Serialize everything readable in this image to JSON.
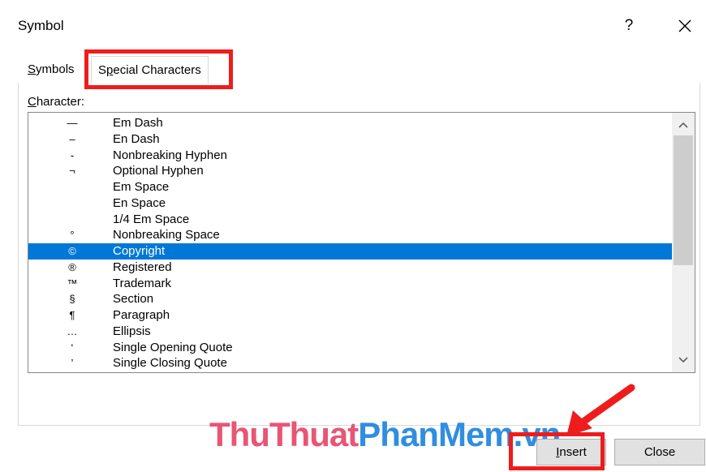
{
  "dialog": {
    "title": "Symbol",
    "help_label": "?",
    "close_icon": "close-icon"
  },
  "tabs": [
    {
      "label": "Symbols",
      "access_key_index": 0,
      "selected": false
    },
    {
      "label": "Special Characters",
      "access_key_index": 1,
      "selected": true
    }
  ],
  "list": {
    "label": "Character:",
    "items": [
      {
        "glyph": "—",
        "name": "Em Dash"
      },
      {
        "glyph": "–",
        "name": "En Dash"
      },
      {
        "glyph": "-",
        "name": "Nonbreaking Hyphen"
      },
      {
        "glyph": "¬",
        "name": "Optional Hyphen"
      },
      {
        "glyph": "",
        "name": "Em Space"
      },
      {
        "glyph": "",
        "name": "En Space"
      },
      {
        "glyph": "",
        "name": "1/4 Em Space"
      },
      {
        "glyph": "°",
        "name": "Nonbreaking Space"
      },
      {
        "glyph": "©",
        "name": "Copyright"
      },
      {
        "glyph": "®",
        "name": "Registered"
      },
      {
        "glyph": "™",
        "name": "Trademark"
      },
      {
        "glyph": "§",
        "name": "Section"
      },
      {
        "glyph": "¶",
        "name": "Paragraph"
      },
      {
        "glyph": "…",
        "name": "Ellipsis"
      },
      {
        "glyph": "‘",
        "name": "Single Opening Quote"
      },
      {
        "glyph": "’",
        "name": "Single Closing Quote"
      }
    ],
    "selected_index": 8
  },
  "buttons": {
    "insert": "Insert",
    "close": "Close"
  },
  "watermark": {
    "part1": "ThuThuat",
    "part2": "PhanMem.vn"
  },
  "colors": {
    "selection": "#0078d7",
    "highlight": "#ee1c1c",
    "watermark_pink": "#e85575",
    "watermark_blue": "#2f8ee0"
  }
}
